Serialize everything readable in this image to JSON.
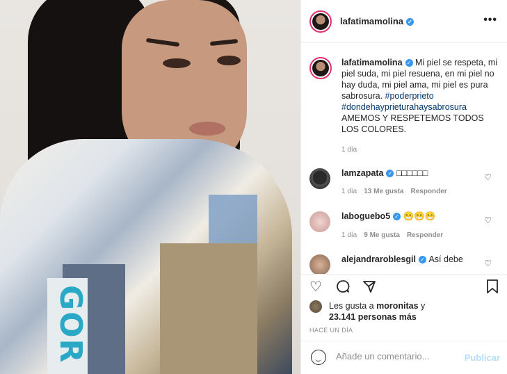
{
  "post": {
    "username": "lafatimamolina",
    "verified_icon": "verified-badge-icon",
    "more_icon": "more-options-icon",
    "caption_pre": " Mi piel se respeta, mi piel suda, mi piel resuena, en mi piel no hay duda, mi piel ama, mi piel es pura sabrosura. ",
    "hashtag1": "#poderprieto",
    "hashtag2": "#dondehayprieturahaysabrosura",
    "caption_post": " AMEMOS Y RESPETEMOS TODOS LOS COLORES.",
    "caption_time": "1 día",
    "photo_text": "GOR"
  },
  "comments": [
    {
      "user": "lamzapata",
      "text": "□□□□□□",
      "time": "1 día",
      "likes": "13 Me gusta",
      "reply": "Responder"
    },
    {
      "user": "laboguebo5",
      "text": "😁😁😁",
      "time": "1 día",
      "likes": "9 Me gusta",
      "reply": "Responder"
    },
    {
      "user": "alejandraroblesgil",
      "text": "Así debe"
    }
  ],
  "likes": {
    "prefix": "Les gusta a ",
    "user": "moronitas",
    "mid": " y ",
    "count": "23.141 personas más"
  },
  "time_ago": "HACE UN DÍA",
  "add_comment": {
    "placeholder": "Añade un comentario...",
    "publish": "Publicar"
  },
  "icons": {
    "like": "heart-icon",
    "comment": "comment-icon",
    "share": "share-icon",
    "save": "bookmark-icon"
  }
}
